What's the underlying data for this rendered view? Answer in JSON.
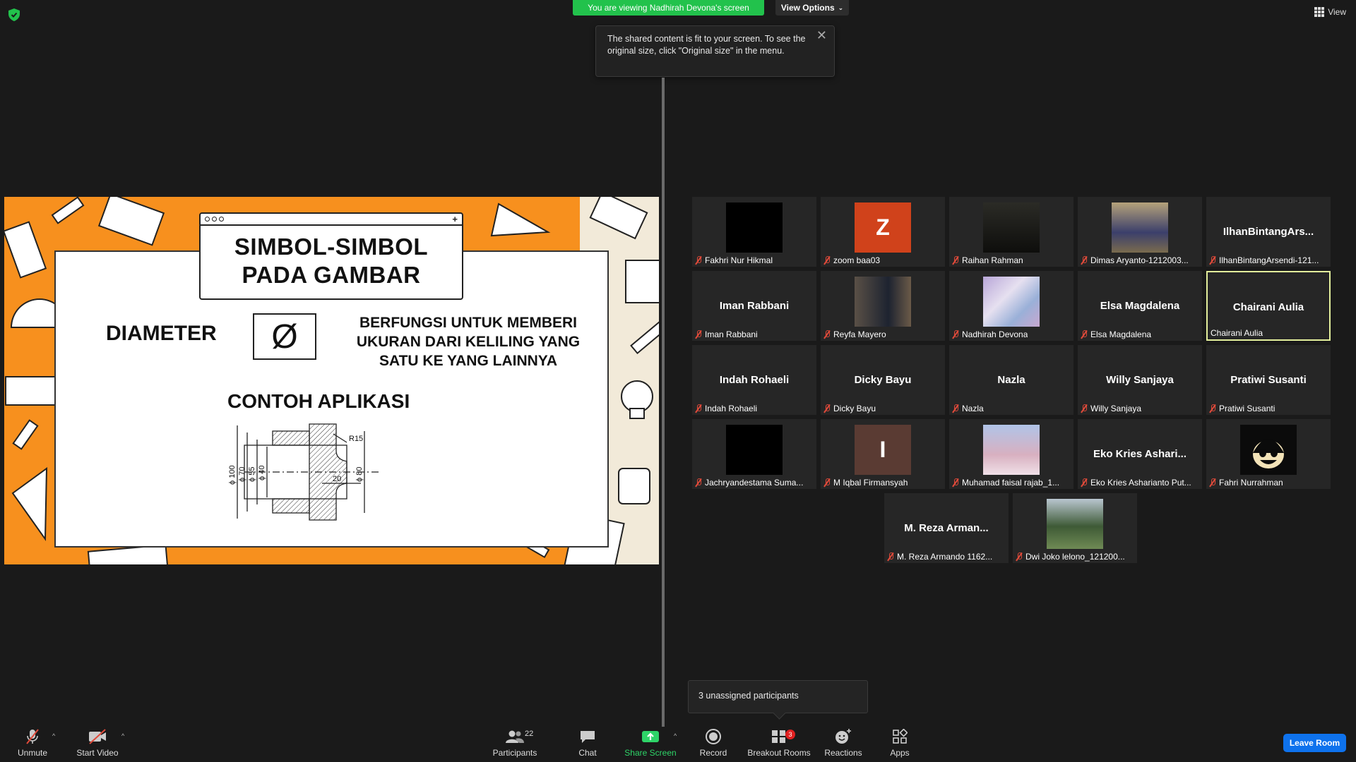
{
  "topbar": {
    "viewing_banner": "You are viewing Nadhirah Devona's screen",
    "view_options": "View Options",
    "view_label": "View"
  },
  "tooltip": {
    "text": "The shared content is fit to your screen. To see the original size, click \"Original size\" in the menu."
  },
  "slide": {
    "title_line1": "SIMBOL-SIMBOL",
    "title_line2": "PADA GAMBAR",
    "term": "DIAMETER",
    "symbol": "Ø",
    "desc_line1": "BERFUNGSI UNTUK MEMBERI",
    "desc_line2": "UKURAN DARI KELILING YANG",
    "desc_line3": "SATU KE YANG LAINNYA",
    "example_title": "CONTOH APLIKASI",
    "dims": {
      "d100": "ϕ 100",
      "d70": "ϕ 70",
      "d55": "ϕ 55",
      "d40": "ϕ 40",
      "d80": "ϕ 80",
      "r15": "R15",
      "len20": "20"
    }
  },
  "participants": [
    {
      "label": "Fakhri Nur Hikmal",
      "video": "black"
    },
    {
      "label": "zoom baa03",
      "avatar_letter": "Z",
      "avatar_color": "#d0421b"
    },
    {
      "label": "Raihan Rahman",
      "video": "photo-dark"
    },
    {
      "label": "Dimas Aryanto-1212003...",
      "video": "photo-sit"
    },
    {
      "label": "IlhanBintangArsendi-121...",
      "center": "IlhanBintangArs..."
    },
    {
      "label": "Iman Rabbani",
      "center": "Iman Rabbani"
    },
    {
      "label": "Reyfa Mayero",
      "video": "photo-man"
    },
    {
      "label": "Nadhirah Devona",
      "video": "photo-pastel"
    },
    {
      "label": "Elsa Magdalena",
      "center": "Elsa Magdalena"
    },
    {
      "label": "Chairani Aulia",
      "center": "Chairani Aulia",
      "active": true
    },
    {
      "label": "Indah Rohaeli",
      "center": "Indah Rohaeli"
    },
    {
      "label": "Dicky Bayu",
      "center": "Dicky Bayu"
    },
    {
      "label": "Nazla",
      "center": "Nazla"
    },
    {
      "label": "Willy Sanjaya",
      "center": "Willy Sanjaya"
    },
    {
      "label": "Pratiwi Susanti",
      "center": "Pratiwi Susanti"
    },
    {
      "label": "Jachryandestama Suma...",
      "video": "black"
    },
    {
      "label": "M Iqbal Firmansyah",
      "avatar_letter": "I",
      "avatar_color": "#5a3b33"
    },
    {
      "label": "Muhamad faisal rajab_1...",
      "video": "photo-sunglass"
    },
    {
      "label": "Eko Kries Asharianto Put...",
      "center": "Eko Kries Ashari..."
    },
    {
      "label": "Fahri Nurrahman",
      "video": "photo-cartoon"
    },
    {
      "label": "M. Reza Armando 1162...",
      "center": "M. Reza Arman..."
    },
    {
      "label": "Dwi Joko lelono_121200...",
      "video": "photo-outdoor"
    }
  ],
  "unassigned": "3 unassigned participants",
  "toolbar": {
    "unmute": "Unmute",
    "start_video": "Start Video",
    "participants": "Participants",
    "participants_count": "22",
    "chat": "Chat",
    "share_screen": "Share Screen",
    "record": "Record",
    "breakout_rooms": "Breakout Rooms",
    "breakout_badge": "3",
    "reactions": "Reactions",
    "apps": "Apps",
    "leave_room": "Leave Room"
  },
  "colors": {
    "banner_green": "#22c24c",
    "share_green": "#2ed468",
    "leave_blue": "#0e72ed",
    "active_border": "#e3ef9c",
    "slide_orange": "#f7901e",
    "muted_red": "#e04a3a"
  }
}
